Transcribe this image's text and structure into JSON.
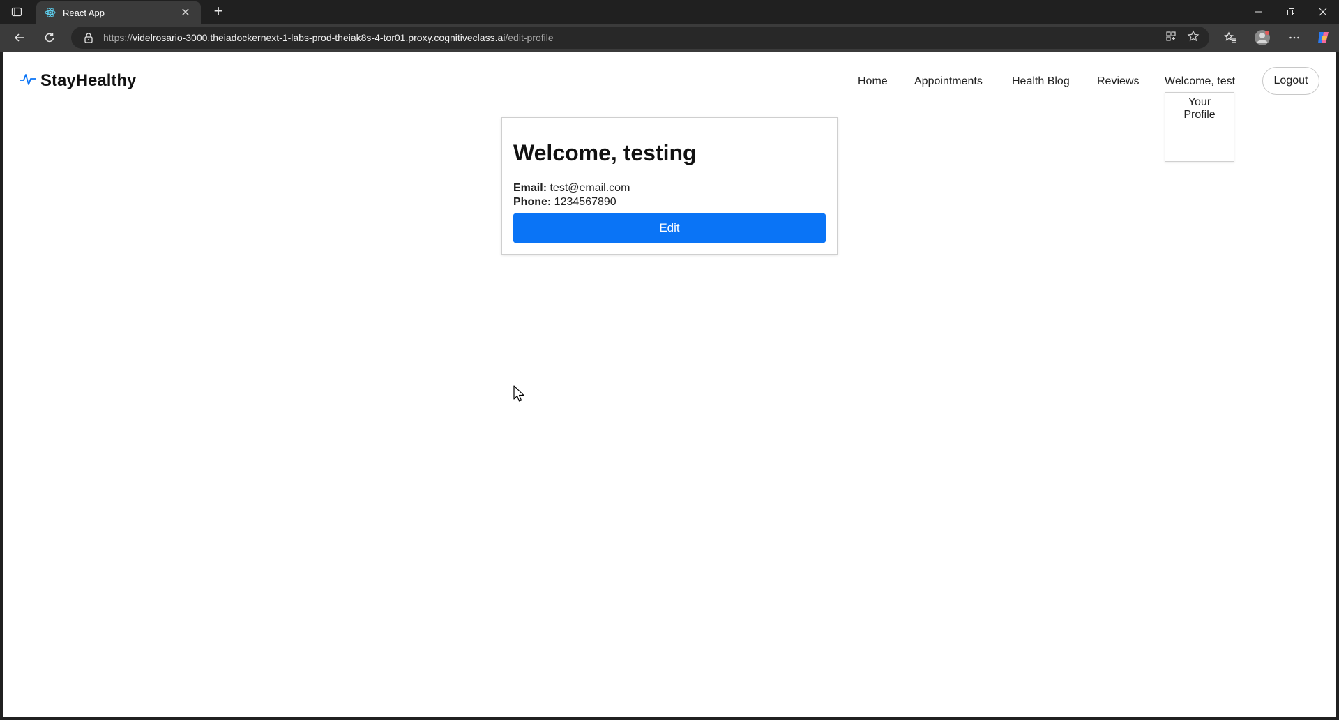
{
  "browser": {
    "tab_title": "React App",
    "url_scheme": "https://",
    "url_host": "videlrosario-3000.theiadockernext-1-labs-prod-theiak8s-4-tor01.proxy.cognitiveclass.ai",
    "url_path": "/edit-profile",
    "icons": [
      "tab-actions-icon",
      "react-favicon-icon",
      "close-icon",
      "plus-icon",
      "minimize-icon",
      "restore-icon",
      "close-window-icon",
      "back-arrow-icon",
      "refresh-icon",
      "lock-icon",
      "app-install-icon",
      "star-icon",
      "favorites-icon",
      "profile-avatar-icon",
      "more-icon",
      "copilot-icon"
    ]
  },
  "app": {
    "brand": "StayHealthy",
    "brand_icon": "pulse-icon",
    "accent_color": "#0a74f6",
    "nav": {
      "home": "Home",
      "appointments": "Appointments",
      "health_blog": "Health Blog",
      "reviews": "Reviews",
      "welcome": "Welcome, test",
      "logout": "Logout"
    },
    "dropdown": {
      "your_profile": "Your Profile"
    },
    "profile": {
      "heading": "Welcome, testing",
      "email_label": "Email:",
      "email_value": "test@email.com",
      "phone_label": "Phone:",
      "phone_value": "1234567890",
      "edit_label": "Edit"
    }
  }
}
